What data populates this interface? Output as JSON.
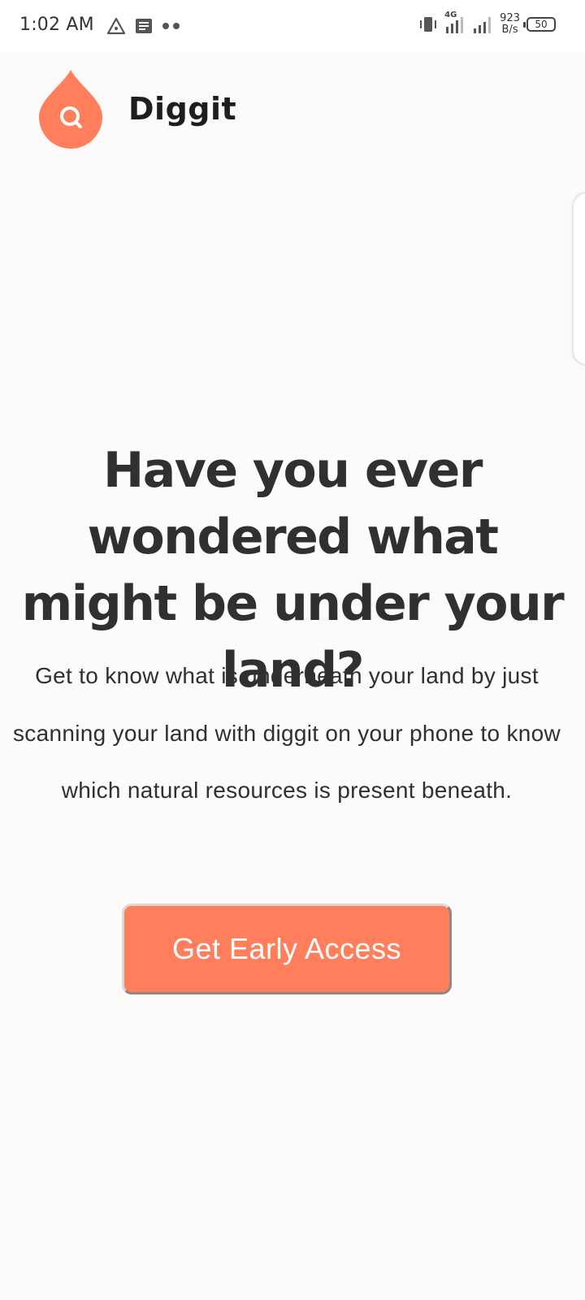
{
  "status_bar": {
    "time": "1:02 AM",
    "network_type": "4G",
    "net_speed_value": "923",
    "net_speed_unit": "B/s",
    "battery_level": "50"
  },
  "header": {
    "brand_name": "Diggit",
    "logo_icon": "search-droplet-icon",
    "accent_color": "#ff7f5c"
  },
  "hero": {
    "headline": "Have you ever wondered what might be under your land?",
    "description": "Get to know what is underneath your land by just scanning your land with diggit on your phone to know which natural resources is present beneath.",
    "cta_label": "Get Early Access"
  }
}
